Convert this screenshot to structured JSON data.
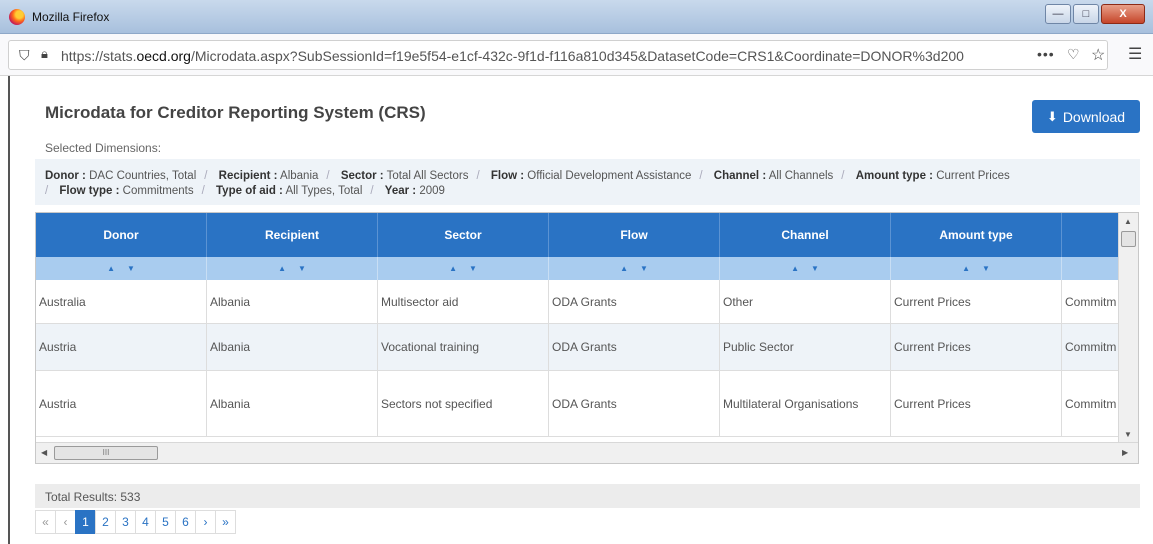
{
  "window": {
    "title": "Mozilla Firefox",
    "btn_min": "—",
    "btn_max": "□",
    "btn_close": "X"
  },
  "browser": {
    "url_prefix": "https://stats.",
    "url_domain": "oecd.org",
    "url_rest": "/Microdata.aspx?SubSessionId=f19e5f54-e1cf-432c-9f1d-f116a810d345&DatasetCode=CRS1&Coordinate=DONOR%3d200",
    "url_more": "•••"
  },
  "page": {
    "title": "Microdata for Creditor Reporting System (CRS)",
    "download_label": "Download",
    "selected_dimensions_label": "Selected Dimensions:"
  },
  "dimensions": {
    "donor_k": "Donor :",
    "donor_v": "DAC Countries, Total",
    "recipient_k": "Recipient :",
    "recipient_v": "Albania",
    "sector_k": "Sector :",
    "sector_v": "Total All Sectors",
    "flow_k": "Flow :",
    "flow_v": "Official Development Assistance",
    "channel_k": "Channel :",
    "channel_v": "All Channels",
    "amount_k": "Amount type :",
    "amount_v": "Current Prices",
    "flowtype_k": "Flow type :",
    "flowtype_v": "Commitments",
    "aid_k": "Type of aid :",
    "aid_v": "All Types, Total",
    "year_k": "Year :",
    "year_v": "2009"
  },
  "table": {
    "headers": [
      "Donor",
      "Recipient",
      "Sector",
      "Flow",
      "Channel",
      "Amount type",
      ""
    ],
    "rows": [
      [
        "Australia",
        "Albania",
        "Multisector aid",
        "ODA Grants",
        "Other",
        "Current Prices",
        "Commitm"
      ],
      [
        "Austria",
        "Albania",
        "Vocational training",
        "ODA Grants",
        "Public Sector",
        "Current Prices",
        "Commitm"
      ],
      [
        "Austria",
        "Albania",
        "Sectors not specified",
        "ODA Grants",
        "Multilateral Organisations",
        "Current Prices",
        "Commitm"
      ]
    ]
  },
  "footer": {
    "total_results": "Total Results: 533"
  },
  "pager": {
    "first": "«",
    "prev": "‹",
    "pages": [
      "1",
      "2",
      "3",
      "4",
      "5",
      "6"
    ],
    "next": "›",
    "last": "»"
  },
  "colors": {
    "accent": "#2a73c4",
    "sort_row": "#a9ccef",
    "alt_row": "#eef3f8"
  }
}
